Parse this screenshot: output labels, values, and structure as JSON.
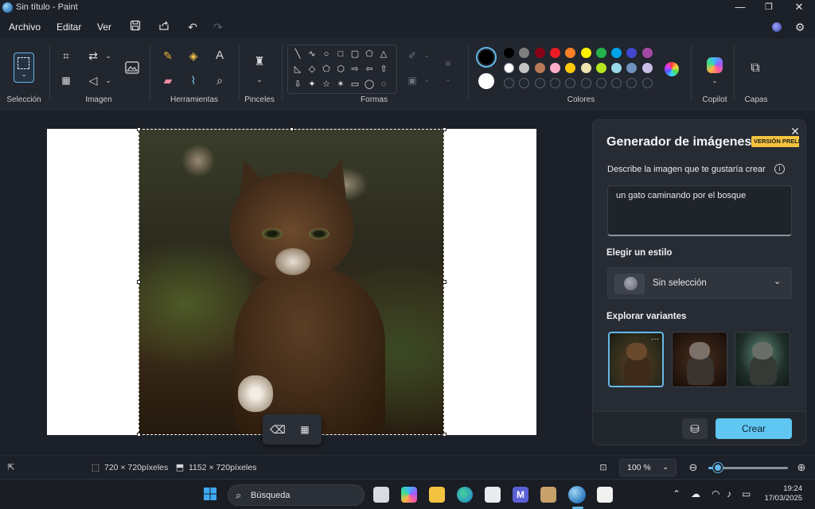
{
  "window": {
    "title": "Sin título - Paint",
    "minimize": "—",
    "maximize": "❐",
    "close": "✕"
  },
  "menu": {
    "file": "Archivo",
    "edit": "Editar",
    "view": "Ver"
  },
  "ribbon": {
    "groups": {
      "selection": "Selección",
      "image": "Imagen",
      "tools": "Herramientas",
      "brushes": "Pinceles",
      "shapes": "Formas",
      "colors": "Colores",
      "copilot": "Copilot",
      "layers": "Capas"
    },
    "shapes": [
      "╲",
      "∿",
      "○",
      "□",
      "▢",
      "⬠",
      "△",
      "◺",
      "◇",
      "⬠",
      "⬡",
      "⇨",
      "⇦",
      "⇧",
      "⇩",
      "✦",
      "☆",
      "✶",
      "▭",
      "◯",
      "◌"
    ],
    "colors_row1": [
      "#000000",
      "#7f7f7f",
      "#880015",
      "#ed1c24",
      "#ff7f27",
      "#fff200",
      "#22b14c",
      "#00a2e8",
      "#3f48cc",
      "#a349a4"
    ],
    "colors_row2": [
      "#ffffff",
      "#c3c3c3",
      "#b97a57",
      "#ffaec9",
      "#ffc90e",
      "#efe4b0",
      "#b5e61d",
      "#99d9ea",
      "#7092be",
      "#c8bfe7"
    ],
    "primary_color": "#000000",
    "secondary_color": "#ffffff"
  },
  "float_toolbar": {
    "remove_bg": "remove-background",
    "blur": "blur-background"
  },
  "panel": {
    "title": "Generador de imágenes",
    "badge": "VERSIÓN PRELIMINAR",
    "prompt_label": "Describe la imagen que te gustaría crear",
    "prompt_value": "un gato caminando por el bosque",
    "style_label": "Elegir un estilo",
    "style_value": "Sin selección",
    "variants_label": "Explorar variantes",
    "create_button": "Crear",
    "more": "···"
  },
  "status": {
    "selection_size": "720 × 720píxeles",
    "canvas_size": "1152 × 720píxeles",
    "zoom": "100 %",
    "zoom_level": 0.12
  },
  "taskbar": {
    "search_placeholder": "Búsqueda",
    "time": "19:24",
    "date": "17/03/2025"
  }
}
